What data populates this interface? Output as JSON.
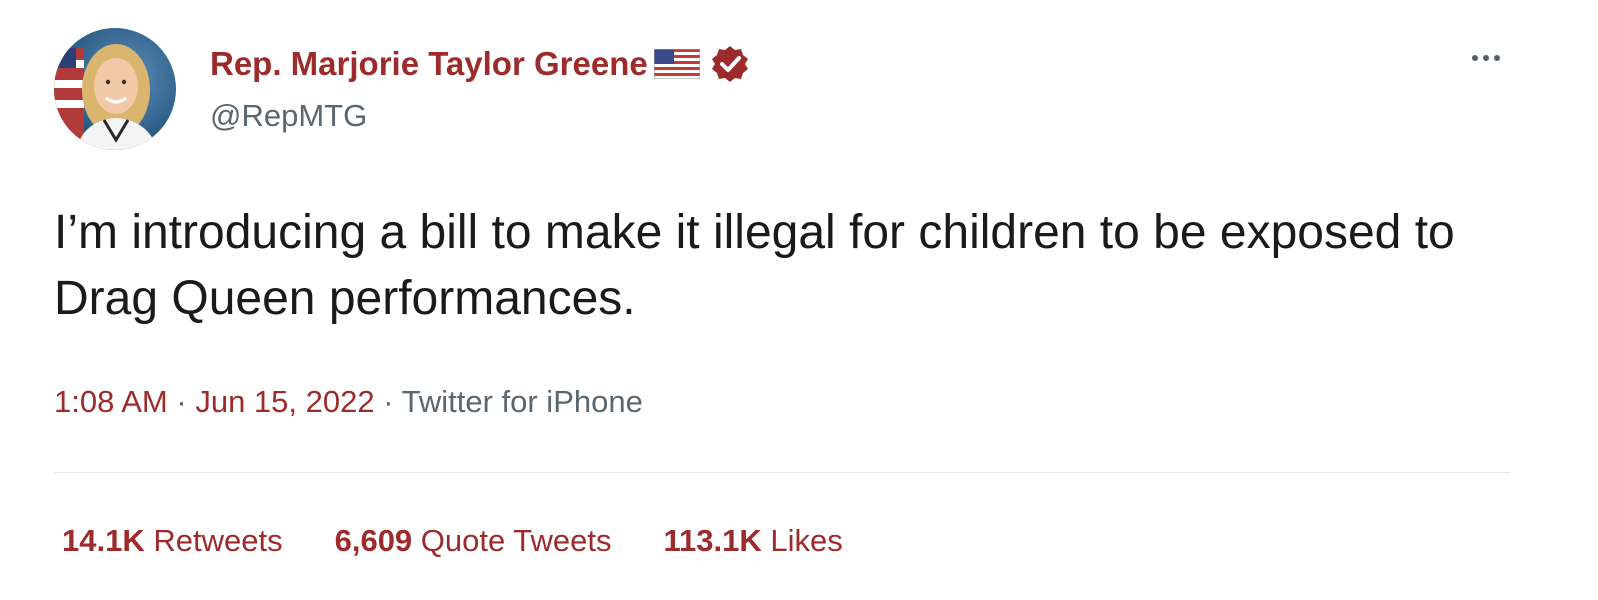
{
  "author": {
    "name": "Rep. Marjorie Taylor Greene",
    "handle": "@RepMTG",
    "flag_icon": "us-flag-icon",
    "verified_icon": "verified-badge-icon",
    "verified_color": "#9e2b2b"
  },
  "tweet": {
    "text": "I’m introducing a bill to make it illegal for children to be exposed to Drag Queen performances.",
    "time": "1:08 AM",
    "separator": "·",
    "date": "Jun 15, 2022",
    "source": "Twitter for iPhone"
  },
  "stats": {
    "retweets_count": "14.1K",
    "retweets_label": "Retweets",
    "quotes_count": "6,609",
    "quotes_label": "Quote Tweets",
    "likes_count": "113.1K",
    "likes_label": "Likes"
  },
  "colors": {
    "accent": "#9e2b2b",
    "secondary_text": "#5a6670",
    "body_text": "#1a1a1a"
  }
}
